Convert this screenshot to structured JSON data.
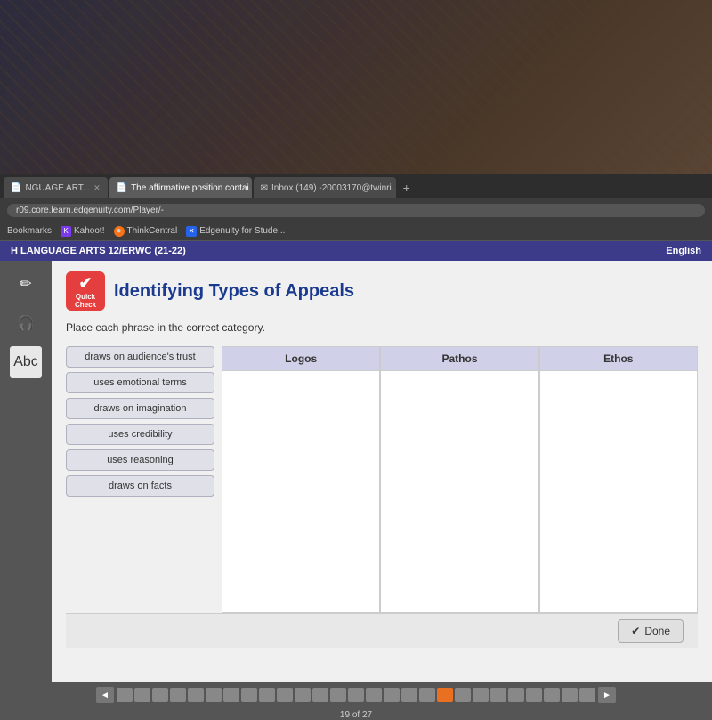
{
  "browser": {
    "tabs": [
      {
        "label": "NGUAGE ART...",
        "active": false,
        "icon": "📄"
      },
      {
        "label": "The affirmative position contai...",
        "active": true,
        "icon": "📄"
      },
      {
        "label": "Inbox (149) -20003170@twinri...",
        "active": false,
        "icon": "✉"
      },
      {
        "label": "+",
        "active": false,
        "icon": ""
      }
    ],
    "address": "r09.core.learn.edgenuity.com/Player/-",
    "bookmarks": [
      {
        "label": "Bookmarks",
        "type": "text"
      },
      {
        "label": "Kahoot!",
        "type": "kahoot"
      },
      {
        "label": "ThinkCentral",
        "type": "think"
      },
      {
        "label": "Edgenuity for Stude...",
        "type": "edge"
      }
    ]
  },
  "topnav": {
    "title": "H LANGUAGE ARTS 12/ERWC (21-22)",
    "right_label": "English"
  },
  "sidebar": {
    "icons": [
      "✏",
      "🎧",
      "Abc"
    ]
  },
  "activity": {
    "icon_label": "Quick\nCheck",
    "title": "Identifying Types of Appeals",
    "instructions": "Place each phrase in the correct category.",
    "phrases": [
      "draws on audience's trust",
      "uses emotional terms",
      "draws on imagination",
      "uses credibility",
      "uses reasoning",
      "draws on facts"
    ],
    "categories": [
      {
        "label": "Logos",
        "items": []
      },
      {
        "label": "Pathos",
        "items": []
      },
      {
        "label": "Ethos",
        "items": []
      }
    ]
  },
  "toolbar": {
    "done_label": "Done",
    "done_icon": "✔"
  },
  "pagination": {
    "current": 19,
    "total": 27,
    "prev_icon": "◄",
    "next_icon": "►",
    "page_count_label": "19 of 27",
    "dots": [
      1,
      2,
      3,
      4,
      5,
      6,
      7,
      8,
      9,
      10,
      11,
      12,
      13,
      14,
      15,
      16,
      17,
      18,
      19,
      20,
      21,
      22,
      23,
      24,
      25,
      26,
      27
    ]
  }
}
